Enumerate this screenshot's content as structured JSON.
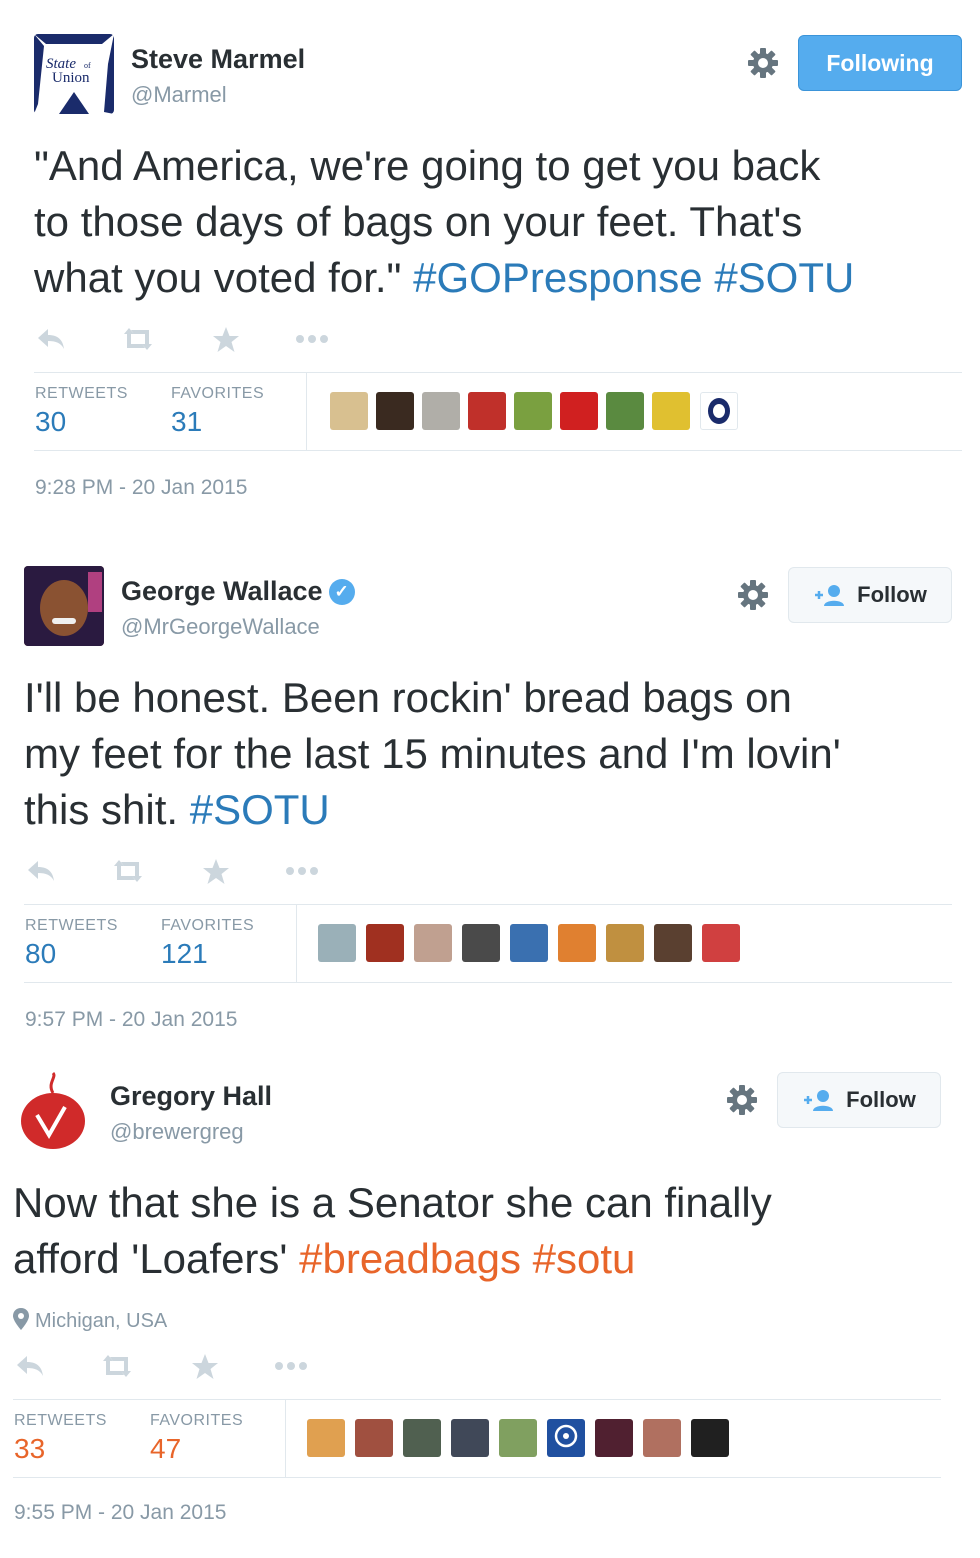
{
  "colors": {
    "link_blue": "#2b7bb9",
    "link_orange": "#e8652a",
    "follow_blue": "#55acee",
    "muted": "#8899a6"
  },
  "tweets": [
    {
      "name": "Steve Marmel",
      "handle": "@Marmel",
      "avatar_text_1": "State",
      "avatar_text_2": "of",
      "avatar_text_3": "Union",
      "button": "Following",
      "text_line1": "\"And America, we're going to get you back",
      "text_line2": "to those days of bags on your feet. That's",
      "text_line3_plain": "what you voted for.\" ",
      "text_tag1": "#GOPresponse",
      "text_tag2": "#SOTU",
      "retweets_label": "RETWEETS",
      "retweets": "30",
      "favorites_label": "FAVORITES",
      "favorites": "31",
      "timestamp": "9:28 PM - 20 Jan 2015"
    },
    {
      "name": "George Wallace",
      "handle": "@MrGeorgeWallace",
      "verified": true,
      "button": "Follow",
      "text_line1": "I'll be honest. Been rockin' bread bags on",
      "text_line2": "my feet for the last 15 minutes and I'm lovin'",
      "text_line3_plain": "this shit. ",
      "text_tag1": "#SOTU",
      "retweets_label": "RETWEETS",
      "retweets": "80",
      "favorites_label": "FAVORITES",
      "favorites": "121",
      "timestamp": "9:57 PM - 20 Jan 2015"
    },
    {
      "name": "Gregory Hall",
      "handle": "@brewergreg",
      "button": "Follow",
      "text_line1": "Now that she is a Senator she can finally",
      "text_line2_plain": "afford 'Loafers' ",
      "text_tag1": "#breadbags",
      "text_tag2": "#sotu",
      "location": "Michigan, USA",
      "retweets_label": "RETWEETS",
      "retweets": "33",
      "favorites_label": "FAVORITES",
      "favorites": "47",
      "timestamp": "9:55 PM - 20 Jan 2015"
    }
  ],
  "icons": [
    "reply-icon",
    "retweet-icon",
    "favorite-icon",
    "more-icon",
    "gear-icon",
    "follow-person-icon",
    "location-pin-icon",
    "verified-badge-icon"
  ]
}
